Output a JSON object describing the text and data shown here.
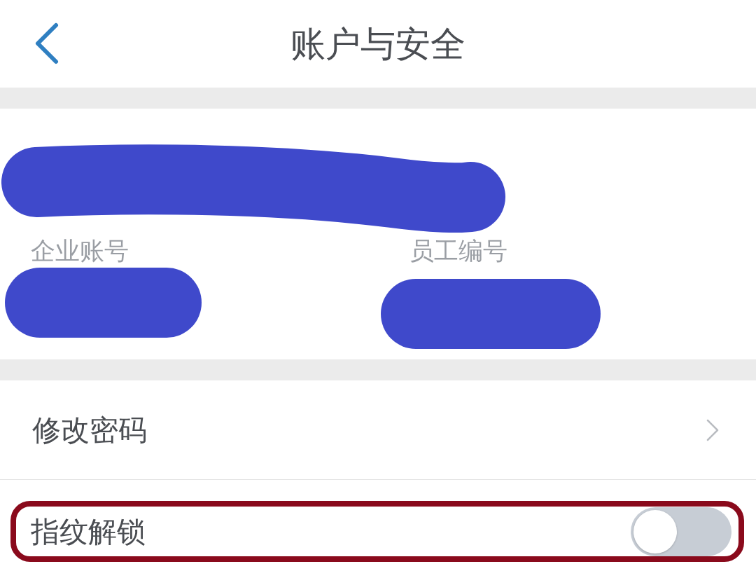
{
  "header": {
    "title": "账户与安全"
  },
  "account_card": {
    "name_redacted": true,
    "fields": [
      {
        "label": "企业账号",
        "redacted": true
      },
      {
        "label": "员工编号",
        "redacted": true
      }
    ]
  },
  "settings": [
    {
      "kind": "link",
      "label": "修改密码",
      "highlighted": false
    },
    {
      "kind": "toggle",
      "label": "指纹解锁",
      "on": false,
      "highlighted": true
    }
  ]
}
